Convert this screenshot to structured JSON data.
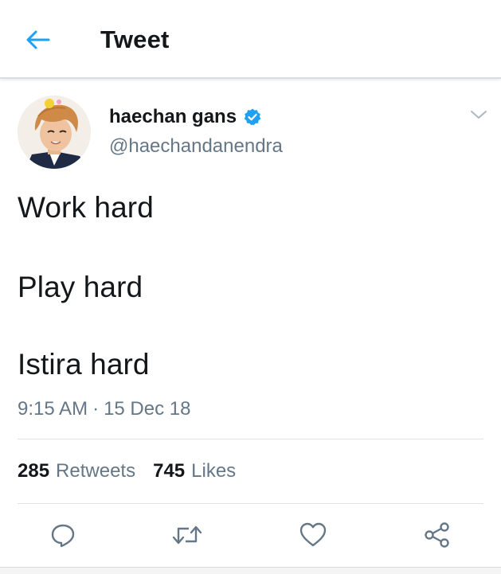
{
  "header": {
    "title": "Tweet",
    "back_icon": "arrow-left-icon"
  },
  "author": {
    "display_name": "haechan gans",
    "handle": "@haechandanendra",
    "verified": true
  },
  "tweet": {
    "lines": [
      "Work hard",
      "Play hard",
      "Istira hard"
    ],
    "time": "9:15 AM",
    "separator": "·",
    "date": "15 Dec 18"
  },
  "stats": {
    "retweets_count": "285",
    "retweets_label": "Retweets",
    "likes_count": "745",
    "likes_label": "Likes"
  },
  "actions": [
    "reply-icon",
    "retweet-icon",
    "like-icon",
    "share-icon"
  ],
  "colors": {
    "accent": "#1da1f2",
    "text": "#14171a",
    "secondary": "#657786",
    "divider": "#dfe3e6"
  }
}
